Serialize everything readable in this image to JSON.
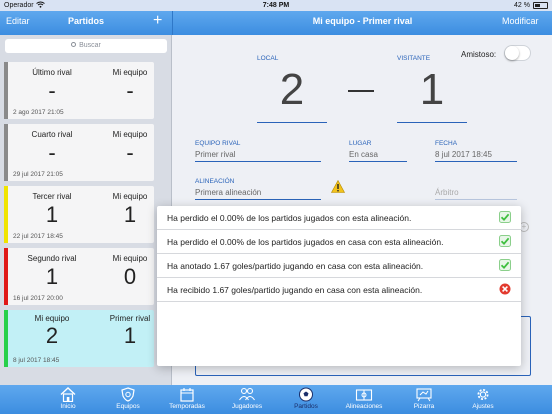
{
  "status_bar": {
    "carrier": "Operador",
    "time": "7:48 PM",
    "battery": "42 %"
  },
  "nav": {
    "left_button": "Editar",
    "left_title": "Partidos",
    "add_button": "+",
    "main_title": "Mi equipo - Primer rival",
    "right_button": "Modificar"
  },
  "sidebar": {
    "search_placeholder": "Buscar",
    "matches": [
      {
        "team1": "Último rival",
        "team2": "Mi equipo",
        "score1": "-",
        "score2": "-",
        "date": "2 ago 2017 21:05",
        "color": "#8a8a8a"
      },
      {
        "team1": "Cuarto rival",
        "team2": "Mi equipo",
        "score1": "-",
        "score2": "-",
        "date": "29 jul 2017 21:05",
        "color": "#8a8a8a"
      },
      {
        "team1": "Tercer rival",
        "team2": "Mi equipo",
        "score1": "1",
        "score2": "1",
        "date": "22 jul 2017 18:45",
        "color": "#f0e400"
      },
      {
        "team1": "Segundo rival",
        "team2": "Mi equipo",
        "score1": "1",
        "score2": "0",
        "date": "16 jul 2017 20:00",
        "color": "#e01818"
      },
      {
        "team1": "Mi equipo",
        "team2": "Primer rival",
        "score1": "2",
        "score2": "1",
        "date": "8 jul 2017 18:45",
        "color": "#28d04a"
      }
    ]
  },
  "detail": {
    "local_label": "LOCAL",
    "visitor_label": "VISITANTE",
    "friendly_label": "Amistoso:",
    "local_score": "2",
    "visitor_score": "1",
    "rival_label": "EQUIPO RIVAL",
    "rival_value": "Primer rival",
    "place_label": "LUGAR",
    "place_value": "En casa",
    "date_label": "FECHA",
    "date_value": "8 jul 2017 18:45",
    "lineup_label": "ALINEACIÓN",
    "lineup_value": "Primera alineación",
    "referee_placeholder": "Árbitro"
  },
  "popover": {
    "rows": [
      {
        "text": "Ha perdido el 0.00% de los partidos jugados con esta alineación.",
        "icon": "check-icon"
      },
      {
        "text": "Ha perdido el 0.00% de los partidos jugados en casa con esta alineación.",
        "icon": "check-icon"
      },
      {
        "text": "Ha anotado 1.67 goles/partido jugando en casa con esta alineación.",
        "icon": "check-icon"
      },
      {
        "text": "Ha recibido 1.67 goles/partido jugando en casa con esta alineación.",
        "icon": "cross-icon"
      }
    ]
  },
  "tabs": [
    {
      "label": "Inicio",
      "icon": "house-icon"
    },
    {
      "label": "Equipos",
      "icon": "shield-icon"
    },
    {
      "label": "Temporadas",
      "icon": "calendar-icon"
    },
    {
      "label": "Jugadores",
      "icon": "players-icon"
    },
    {
      "label": "Partidos",
      "icon": "ball-icon",
      "active": true
    },
    {
      "label": "Alineaciones",
      "icon": "field-icon"
    },
    {
      "label": "Pizarra",
      "icon": "board-icon"
    },
    {
      "label": "Ajustes",
      "icon": "gear-icon"
    }
  ],
  "colors": {
    "accent": "#3c8de0",
    "label_blue": "#2a63b9",
    "selected_row": "#c2f0f6",
    "check_green": "#3fbf3f",
    "cross_red": "#e23a2e"
  }
}
